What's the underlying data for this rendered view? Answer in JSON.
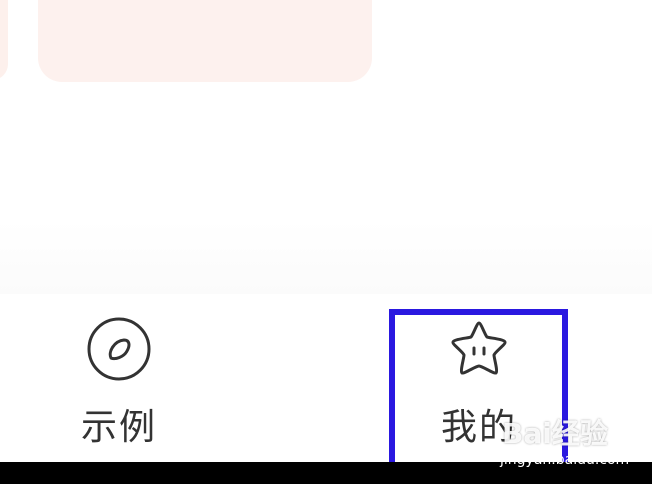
{
  "tabbar": {
    "tabs": [
      {
        "label": "示例",
        "icon": "circle-o-icon"
      },
      {
        "label": "我的",
        "icon": "star-face-icon"
      }
    ],
    "highlight_color": "#2a18e0"
  },
  "watermark": {
    "logo": "Bai经验",
    "url": "jingyan.baidu.com"
  }
}
